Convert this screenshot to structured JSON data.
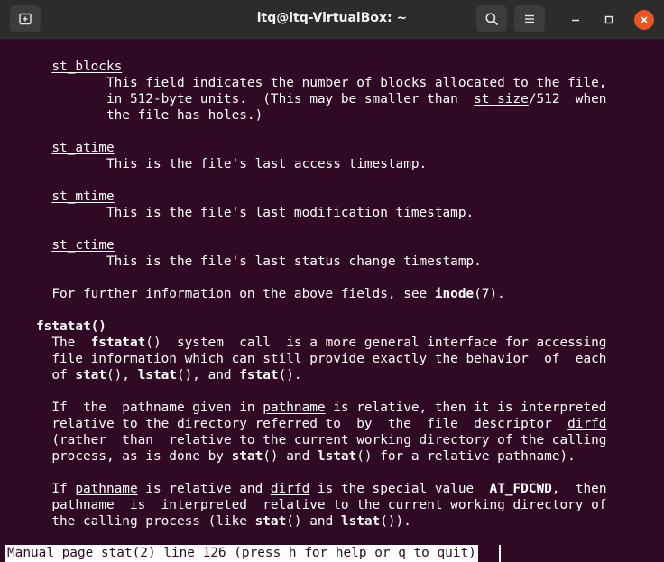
{
  "window": {
    "title": "ltq@ltq-VirtualBox: ~"
  },
  "icons": {
    "new_tab": "new-tab-icon",
    "search": "search-icon",
    "menu": "hamburger-menu-icon",
    "minimize": "minimize-icon",
    "maximize": "maximize-icon",
    "close": "close-icon"
  },
  "colors": {
    "terminal_bg": "#300a24",
    "titlebar_bg": "#2c2c2c",
    "close_button": "#e95420",
    "text": "#ffffff"
  },
  "terminal": {
    "lines": [
      [
        {
          "t": "     "
        },
        {
          "t": "st_blocks",
          "s": "u"
        }
      ],
      [
        {
          "t": "            This field indicates the number of blocks allocated to the file,"
        }
      ],
      [
        {
          "t": "            in 512-byte units.  (This may be smaller than  "
        },
        {
          "t": "st_size",
          "s": "u"
        },
        {
          "t": "/512  when"
        }
      ],
      [
        {
          "t": "            the file has holes.)"
        }
      ],
      [
        {
          "t": ""
        }
      ],
      [
        {
          "t": "     "
        },
        {
          "t": "st_atime",
          "s": "u"
        }
      ],
      [
        {
          "t": "            This is the file's last access timestamp."
        }
      ],
      [
        {
          "t": ""
        }
      ],
      [
        {
          "t": "     "
        },
        {
          "t": "st_mtime",
          "s": "u"
        }
      ],
      [
        {
          "t": "            This is the file's last modification timestamp."
        }
      ],
      [
        {
          "t": ""
        }
      ],
      [
        {
          "t": "     "
        },
        {
          "t": "st_ctime",
          "s": "u"
        }
      ],
      [
        {
          "t": "            This is the file's last status change timestamp."
        }
      ],
      [
        {
          "t": ""
        }
      ],
      [
        {
          "t": "     For further information on the above fields, see "
        },
        {
          "t": "inode",
          "s": "b"
        },
        {
          "t": "(7)."
        }
      ],
      [
        {
          "t": ""
        }
      ],
      [
        {
          "t": "   "
        },
        {
          "t": "fstatat()",
          "s": "b"
        }
      ],
      [
        {
          "t": "     The  "
        },
        {
          "t": "fstatat",
          "s": "b"
        },
        {
          "t": "()  system  call  is a more general interface for accessing"
        }
      ],
      [
        {
          "t": "     file information which can still provide exactly the behavior  of  each"
        }
      ],
      [
        {
          "t": "     of "
        },
        {
          "t": "stat",
          "s": "b"
        },
        {
          "t": "(), "
        },
        {
          "t": "lstat",
          "s": "b"
        },
        {
          "t": "(), and "
        },
        {
          "t": "fstat",
          "s": "b"
        },
        {
          "t": "()."
        }
      ],
      [
        {
          "t": ""
        }
      ],
      [
        {
          "t": "     If  the  pathname given in "
        },
        {
          "t": "pathname",
          "s": "u"
        },
        {
          "t": " is relative, then it is interpreted"
        }
      ],
      [
        {
          "t": "     relative to the directory referred to  by  the  file  descriptor  "
        },
        {
          "t": "dirfd",
          "s": "u"
        }
      ],
      [
        {
          "t": "     (rather  than  relative to the current working directory of the calling"
        }
      ],
      [
        {
          "t": "     process, as is done by "
        },
        {
          "t": "stat",
          "s": "b"
        },
        {
          "t": "() and "
        },
        {
          "t": "lstat",
          "s": "b"
        },
        {
          "t": "() for a relative pathname)."
        }
      ],
      [
        {
          "t": ""
        }
      ],
      [
        {
          "t": "     If "
        },
        {
          "t": "pathname",
          "s": "u"
        },
        {
          "t": " is relative and "
        },
        {
          "t": "dirfd",
          "s": "u"
        },
        {
          "t": " is the special value  "
        },
        {
          "t": "AT_FDCWD",
          "s": "b"
        },
        {
          "t": ",  then"
        }
      ],
      [
        {
          "t": "     "
        },
        {
          "t": "pathname",
          "s": "u"
        },
        {
          "t": "  is  interpreted  relative to the current working directory of"
        }
      ],
      [
        {
          "t": "     the calling process (like "
        },
        {
          "t": "stat",
          "s": "b"
        },
        {
          "t": "() and "
        },
        {
          "t": "lstat",
          "s": "b"
        },
        {
          "t": "())."
        }
      ]
    ],
    "status_line": "Manual page stat(2) line 126 (press h for help or q to quit)"
  }
}
